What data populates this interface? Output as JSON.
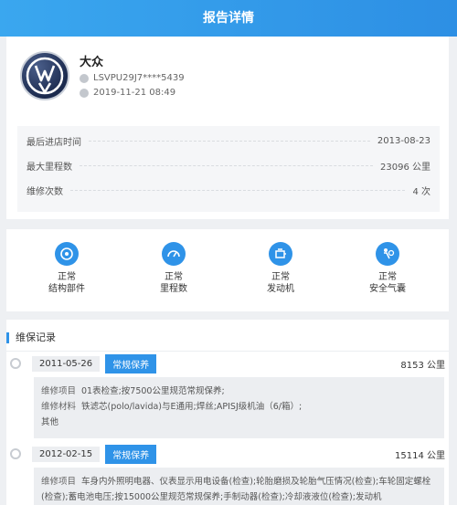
{
  "header": {
    "title": "报告详情"
  },
  "vehicle": {
    "brand": "大众",
    "vin": "LSVPU29J7****5439",
    "datetime": "2019-11-21 08:49"
  },
  "stats": [
    {
      "label": "最后进店时间",
      "value": "2013-08-23"
    },
    {
      "label": "最大里程数",
      "value": "23096 公里"
    },
    {
      "label": "维修次数",
      "value": "4 次"
    }
  ],
  "status": [
    {
      "icon": "structure-icon",
      "value": "正常",
      "label": "结构部件"
    },
    {
      "icon": "odometer-icon",
      "value": "正常",
      "label": "里程数"
    },
    {
      "icon": "engine-icon",
      "value": "正常",
      "label": "发动机"
    },
    {
      "icon": "airbag-icon",
      "value": "正常",
      "label": "安全气囊"
    }
  ],
  "records": {
    "title": "维保记录",
    "items": [
      {
        "date": "2011-05-26",
        "tag": "常规保养",
        "km": "8153 公里",
        "item_key": "维修项目",
        "item_value": "01表检查;按7500公里规范常规保养;",
        "material_key": "维修材料",
        "material_value": "铁滤芯(polo/lavida)与E通用;焊丝;APISJ级机油（6/箱）;",
        "other": "其他"
      },
      {
        "date": "2012-02-15",
        "tag": "常规保养",
        "km": "15114 公里",
        "item_key": "维修项目",
        "item_value": "车身内外照明电器、仪表显示用电设备(检查);轮胎磨损及轮胎气压情况(检查);车轮固定螺栓(检查);蓄电池电压;按15000公里规范常规保养;手制动器(检查);冷却液液位(检查);发动机"
      }
    ]
  },
  "colors": {
    "accent": "#2f93e8",
    "header": "#3aa7ef"
  }
}
